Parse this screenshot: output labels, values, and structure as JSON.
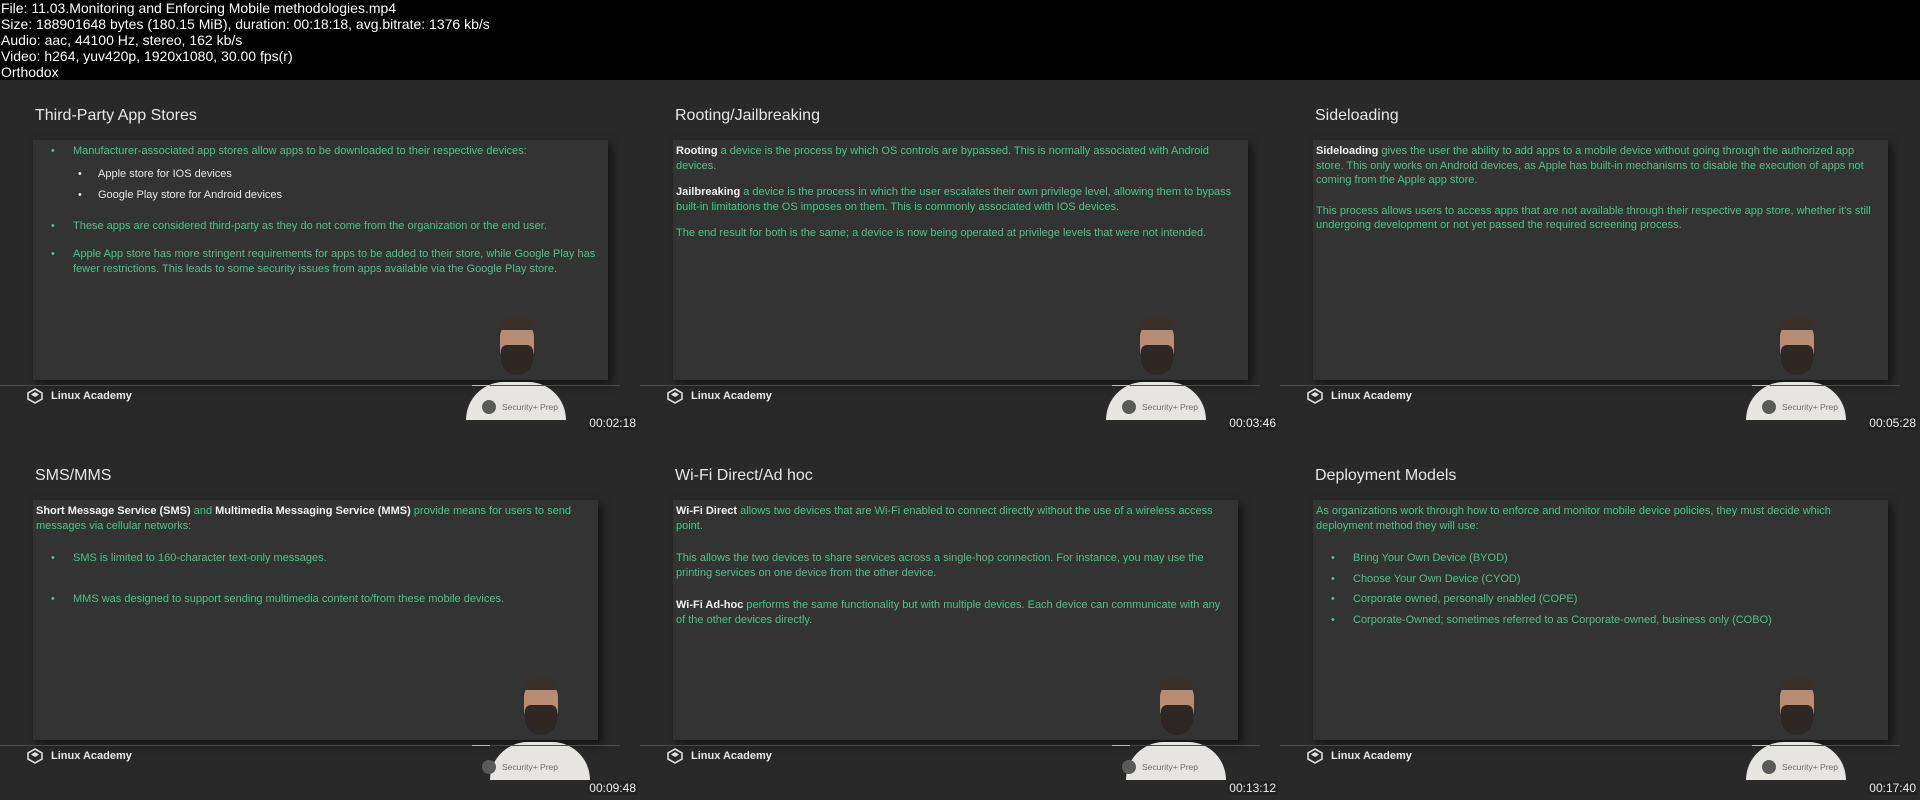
{
  "file_info": {
    "file": "File: 11.03.Monitoring and Enforcing Mobile methodologies.mp4",
    "size": "Size: 188901648 bytes (180.15 MiB), duration: 00:18:18, avg.bitrate: 1376 kb/s",
    "audio": "Audio: aac, 44100 Hz, stereo, 162 kb/s",
    "video": "Video: h264, yuv420p, 1920x1080, 30.00 fps(r)",
    "author": "Orthodox"
  },
  "brand": "Linux Academy",
  "prep_label": "Security+ Prep",
  "tiles": [
    {
      "title": "Third-Party App Stores",
      "timestamp": "00:02:18",
      "b1": "Manufacturer-associated app stores allow apps to be downloaded to their respective devices:",
      "s1": "Apple store for IOS devices",
      "s2": "Google Play store for Android devices",
      "b2": "These apps are considered third-party as they do not come from the organization or the end user.",
      "b3": "Apple App store has more stringent requirements for apps to be added to their store, while Google Play has fewer restrictions. This leads to some security issues from apps available via the Google Play store."
    },
    {
      "title": "Rooting/Jailbreaking",
      "timestamp": "00:03:46",
      "p1_bold": "Rooting",
      "p1": " a device is the process by which OS controls are bypassed. This is normally associated with Android devices.",
      "p2_bold": "Jailbreaking",
      "p2": " a device is the process in which the user escalates their own privilege level, allowing them to bypass built-in limitations the OS imposes on them. This is commonly associated with IOS devices.",
      "p3": "The end result for both is the same; a device is now being operated at privilege levels that were not intended."
    },
    {
      "title": "Sideloading",
      "timestamp": "00:05:28",
      "p1_bold": "Sideloading",
      "p1": " gives the user the ability to add apps to a mobile device without going through the authorized app store. This only works on Android devices, as Apple has built-in mechanisms to disable the execution of apps not coming from the Apple app store.",
      "p2": "This process allows users to access apps that are not available through their respective app store, whether it's still undergoing development or not yet passed the required screening process."
    },
    {
      "title": "SMS/MMS",
      "timestamp": "00:09:48",
      "p1_bold_a": "Short Message Service (SMS)",
      "p1_mid": " and ",
      "p1_bold_b": "Multimedia Messaging Service (MMS)",
      "p1": " provide means for users to send messages via cellular networks:",
      "b1": "SMS is limited to 160-character text-only messages.",
      "b2": "MMS was designed to support sending multimedia content to/from these mobile devices."
    },
    {
      "title": "Wi-Fi Direct/Ad hoc",
      "timestamp": "00:13:12",
      "p1_bold": "Wi-Fi Direct",
      "p1": " allows two devices that are Wi-Fi enabled to connect directly without the use of a wireless access point.",
      "p2": "This allows the two devices to share services across a single-hop connection. For instance, you may use the printing services on one device from the other device.",
      "p3_bold": "Wi-Fi Ad-hoc",
      "p3": " performs the same functionality but with multiple devices. Each device can communicate with any of the other devices directly."
    },
    {
      "title": "Deployment Models",
      "timestamp": "00:17:40",
      "p1": "As organizations work through how to enforce and monitor mobile device policies, they must decide which deployment method they will use:",
      "b1": "Bring Your Own Device (BYOD)",
      "b2": "Choose Your Own Device (CYOD)",
      "b3": "Corporate owned, personally enabled (COPE)",
      "b4": "Corporate-Owned; sometimes referred to as Corporate-owned, business only (COBO)"
    }
  ]
}
